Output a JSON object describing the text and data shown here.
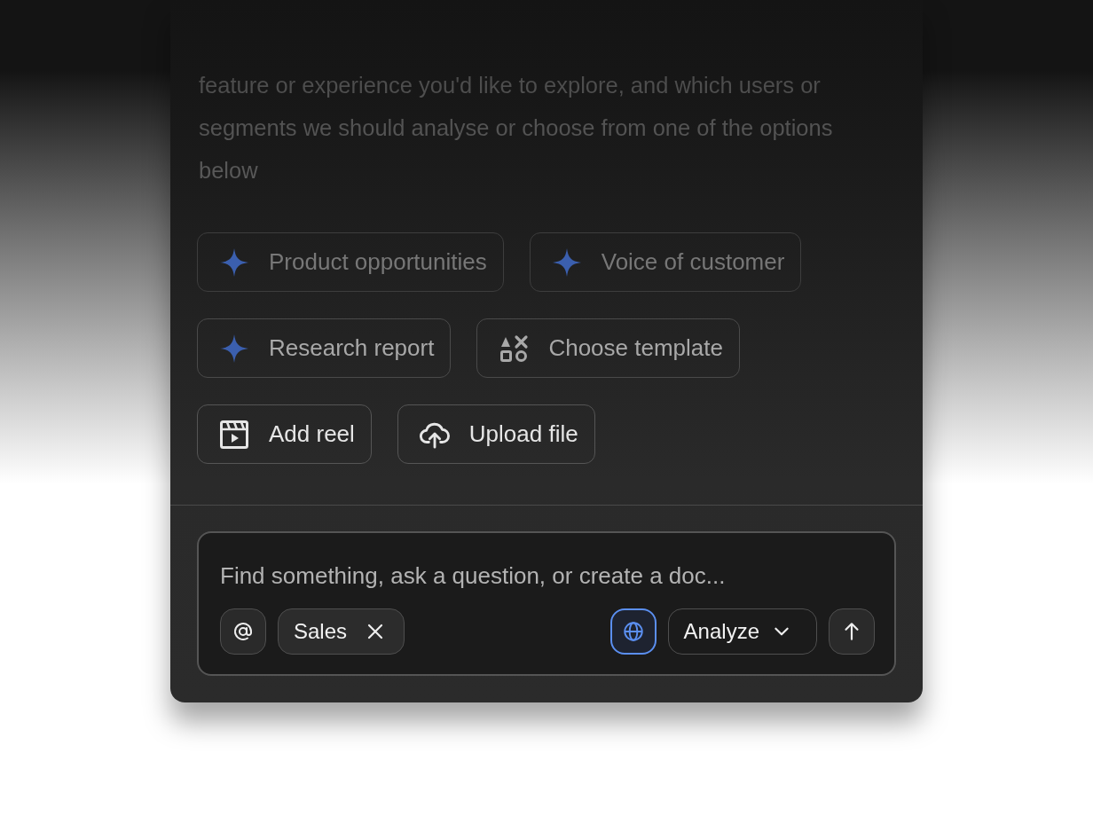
{
  "intro": {
    "text": "feature or experience you'd like to explore, and which users or segments we should analyse or choose from one of the options below"
  },
  "suggestions": [
    [
      {
        "label": "Product opportunities",
        "kind": "sparkle"
      },
      {
        "label": "Voice of customer",
        "kind": "sparkle"
      }
    ],
    [
      {
        "label": "Research report",
        "kind": "sparkle"
      },
      {
        "label": "Choose template",
        "kind": "shapes"
      }
    ],
    [
      {
        "label": "Add reel",
        "kind": "reel"
      },
      {
        "label": "Upload file",
        "kind": "upload"
      }
    ]
  ],
  "composer": {
    "placeholder": "Find something, ask a question, or create a doc...",
    "tag": {
      "label": "Sales"
    },
    "web_search": {
      "on": true
    },
    "mode": {
      "label": "Analyze"
    }
  }
}
